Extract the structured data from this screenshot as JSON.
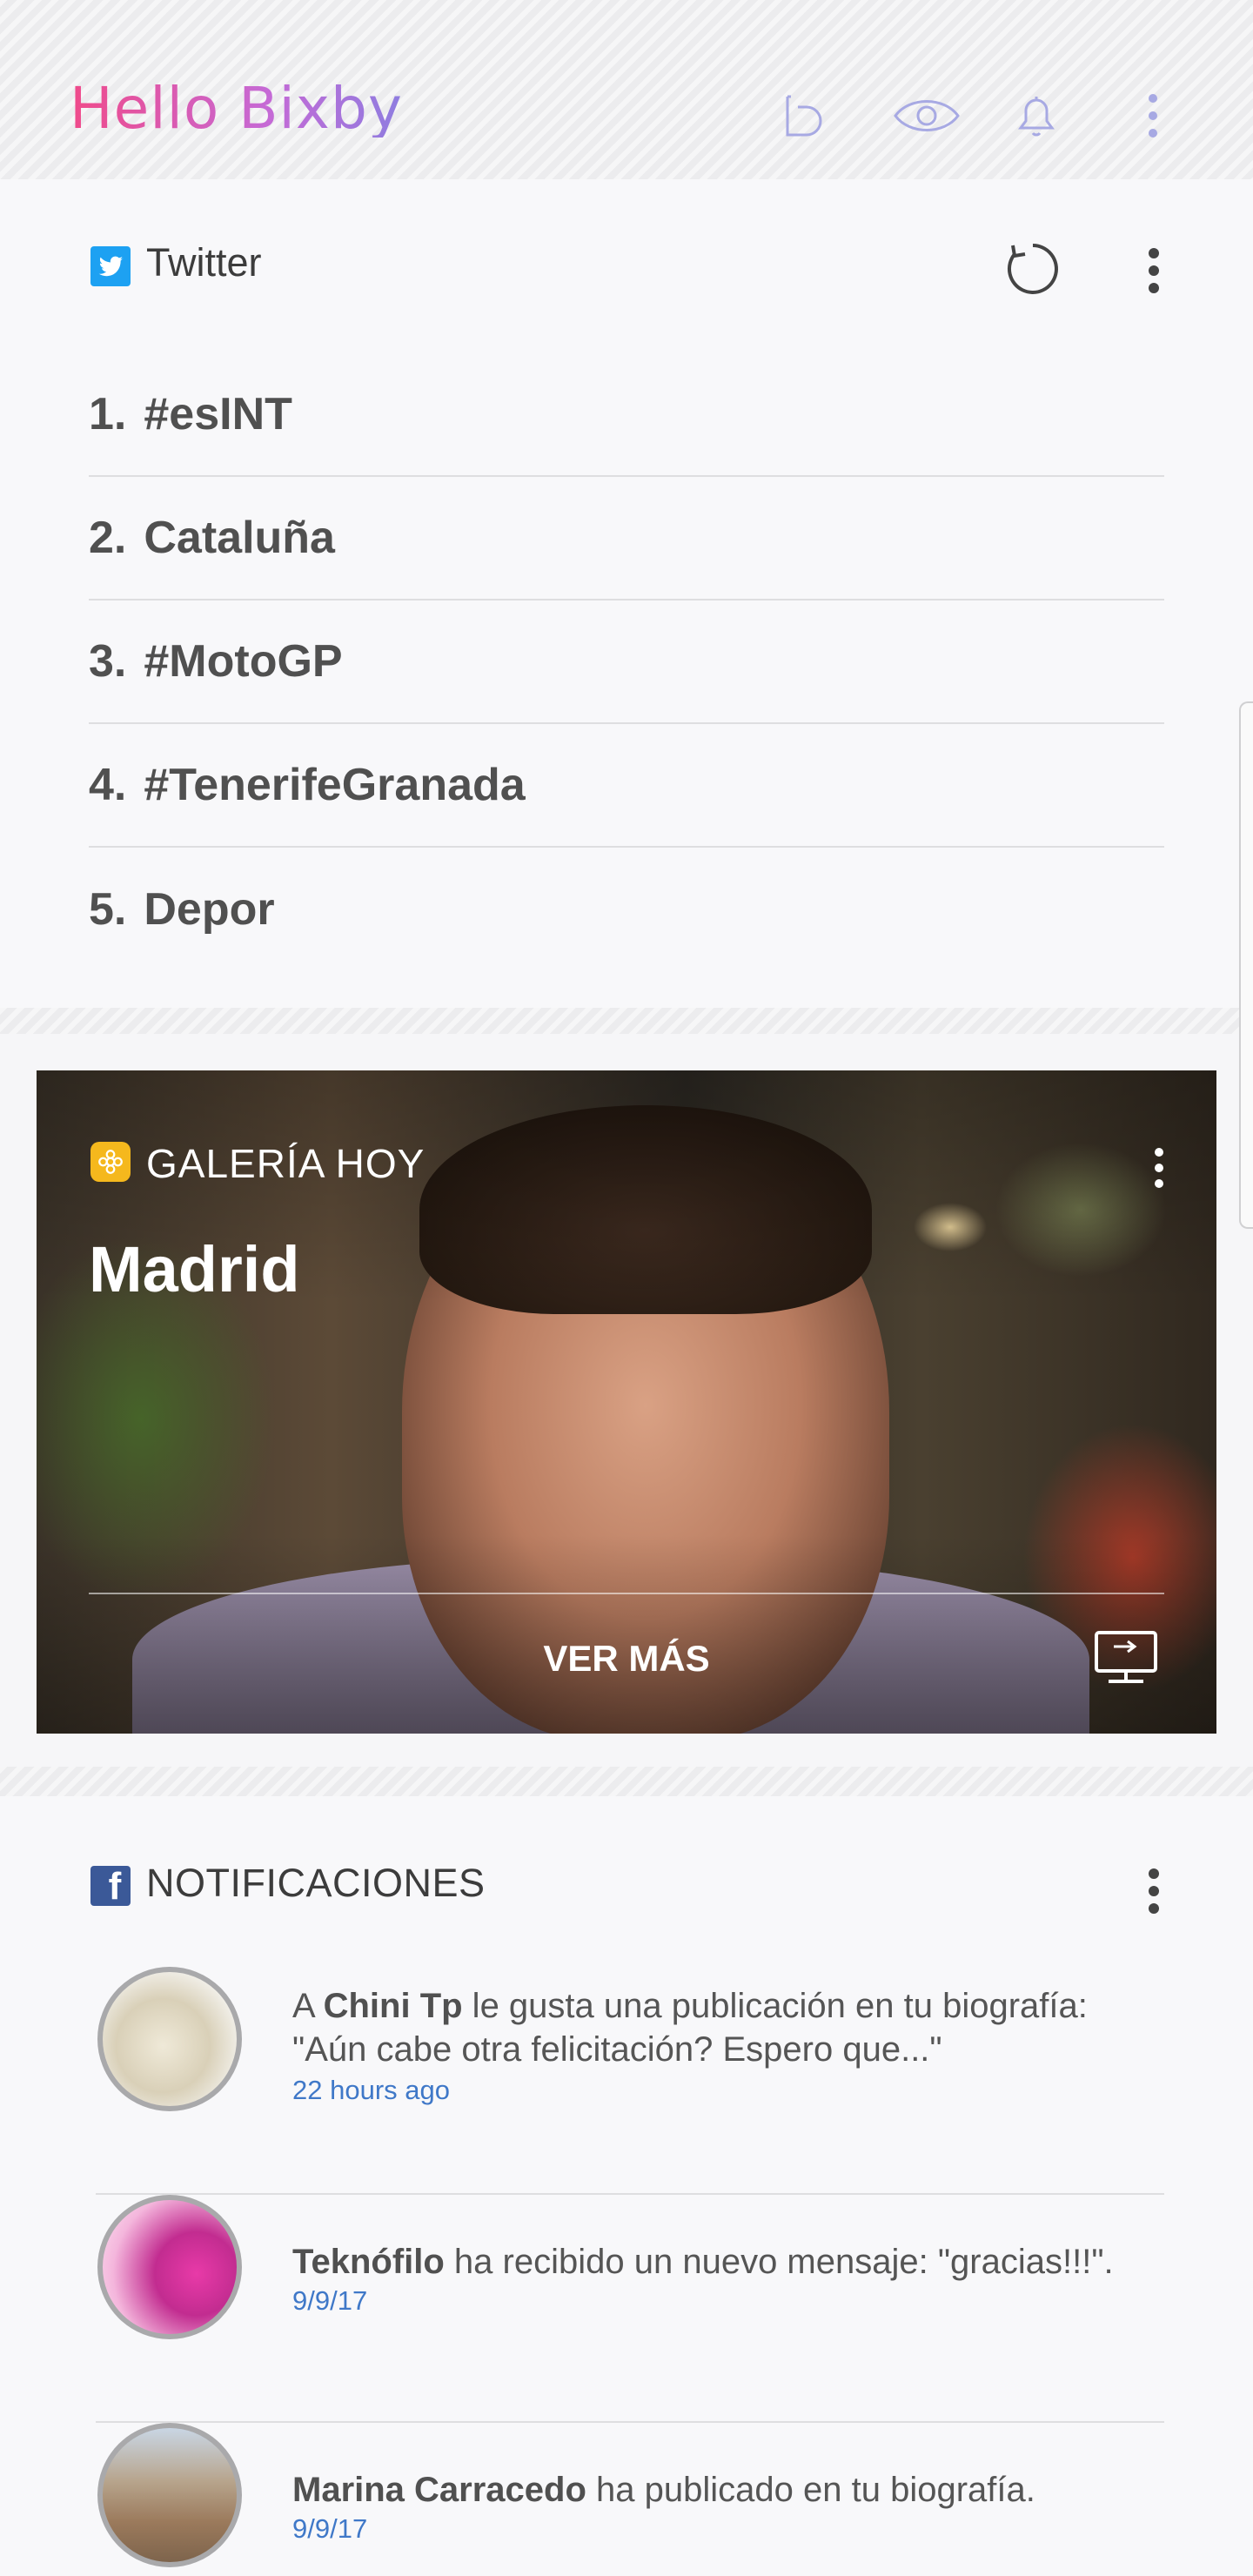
{
  "header": {
    "logo_text": "Hello Bixby",
    "icons": [
      "bixby-icon",
      "vision-eye-icon",
      "reminder-bell-icon",
      "more-vert-icon"
    ]
  },
  "twitter": {
    "title": "Twitter",
    "icon": "twitter-icon",
    "trends": [
      {
        "num": "1.",
        "label": "#esINT"
      },
      {
        "num": "2.",
        "label": "Cataluña"
      },
      {
        "num": "3.",
        "label": "#MotoGP"
      },
      {
        "num": "4.",
        "label": "#TenerifeGranada"
      },
      {
        "num": "5.",
        "label": "Depor"
      }
    ]
  },
  "gallery": {
    "label": "GALERÍA HOY",
    "city": "Madrid",
    "button": "VER MÁS",
    "icon": "gallery-flower-icon",
    "cast_icon": "cast-screen-icon"
  },
  "facebook": {
    "title": "NOTIFICACIONES",
    "icon": "facebook-icon",
    "items": [
      {
        "prefix": "A ",
        "name": "Chini Tp",
        "text": " le gusta una publicación en tu biografía: \"Aún cabe otra felicitación? Espero que...\"",
        "time": "22 hours ago"
      },
      {
        "prefix": "",
        "name": "Teknófilo",
        "text": " ha recibido un nuevo mensaje: \"gracias!!!\".",
        "time": "9/9/17"
      },
      {
        "prefix": "",
        "name": "Marina Carracedo",
        "text": " ha publicado en tu biografía.",
        "time": "9/9/17"
      }
    ]
  },
  "colors": {
    "accent_blue": "#3f78c8",
    "twitter": "#1da1f2",
    "facebook": "#3b5998",
    "bixby_icon": "#a7a9e3"
  }
}
